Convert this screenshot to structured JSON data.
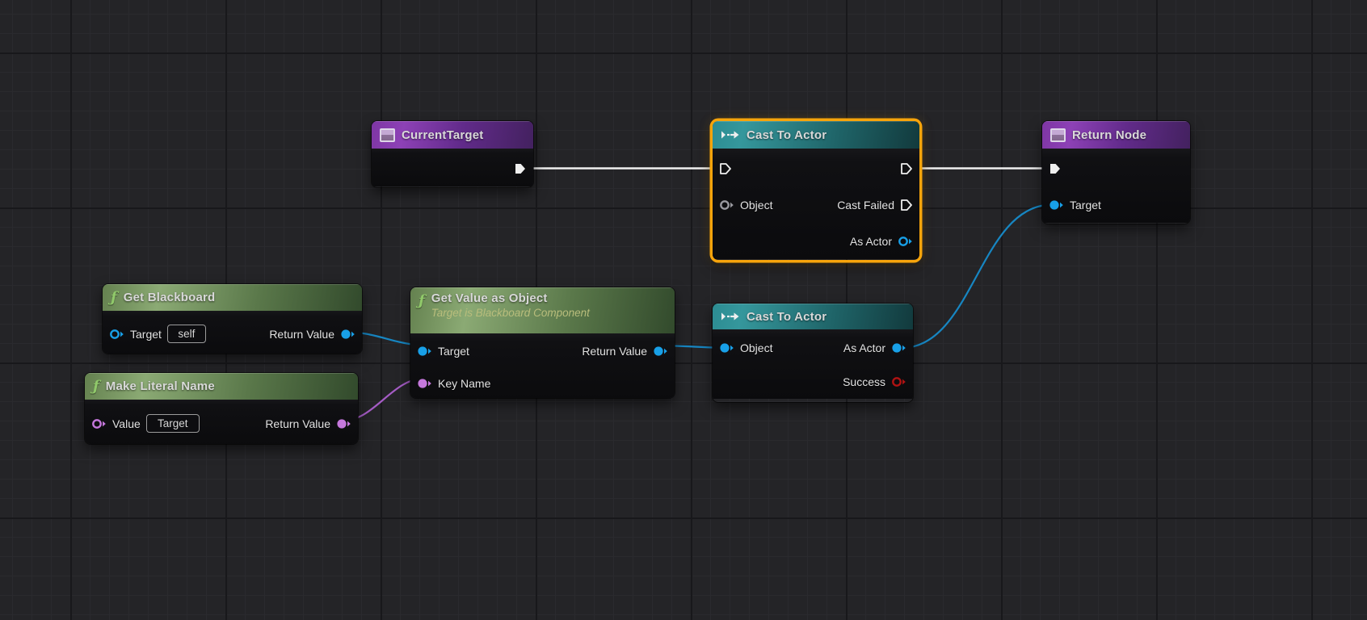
{
  "graph": {
    "tool": "Blueprint node graph",
    "colors": {
      "selection_outline": "#F7A40B",
      "exec_wire": "#EFEFEF",
      "object_pin_blue": "#18A0E8",
      "name_pin_purple": "#C678DD",
      "bool_pin_red": "#B01212",
      "object_pin_gray": "#9A9AA0",
      "header_variable_purple": "#7E36A4",
      "header_cast_teal": "#2C8C92",
      "header_function_green": "#64814F"
    },
    "nodes": {
      "currentTarget": {
        "title": "CurrentTarget"
      },
      "castToActor1": {
        "title": "Cast To Actor",
        "selected": "true",
        "pins": {
          "object": "Object",
          "castFailed": "Cast Failed",
          "asActor": "As Actor"
        }
      },
      "returnNode": {
        "title": "Return Node",
        "pins": {
          "target": "Target"
        }
      },
      "getBlackboard": {
        "title": "Get Blackboard",
        "pins": {
          "target": "Target",
          "targetDefault": "self",
          "returnValue": "Return Value"
        }
      },
      "getValueAsObject": {
        "title": "Get Value as Object",
        "subtitle": "Target is Blackboard Component",
        "pins": {
          "target": "Target",
          "keyName": "Key Name",
          "returnValue": "Return Value"
        }
      },
      "makeLiteralName": {
        "title": "Make Literal Name",
        "pins": {
          "value": "Value",
          "valueDefault": "Target",
          "returnValue": "Return Value"
        }
      },
      "castToActor2": {
        "title": "Cast To Actor",
        "pins": {
          "object": "Object",
          "asActor": "As Actor",
          "success": "Success"
        }
      }
    }
  }
}
